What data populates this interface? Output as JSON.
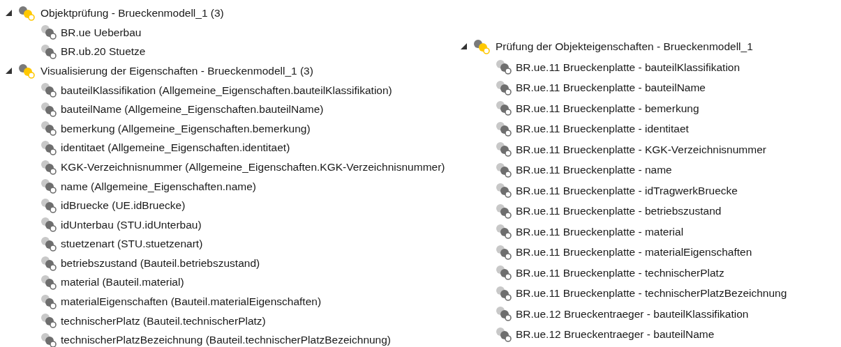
{
  "trees": [
    {
      "groups": [
        {
          "label": "Objektprüfung - Brueckenmodell_1 (3)",
          "expanded": true,
          "children": [
            {
              "label": "BR.ue Ueberbau"
            },
            {
              "label": "BR.ub.20 Stuetze"
            }
          ]
        },
        {
          "label": "Visualisierung der Eigenschaften - Brueckenmodell_1 (3)",
          "expanded": true,
          "children": [
            {
              "label": "bauteilKlassifikation (Allgemeine_Eigenschaften.bauteilKlassifikation)"
            },
            {
              "label": "bauteilName (Allgemeine_Eigenschaften.bauteilName)"
            },
            {
              "label": "bemerkung (Allgemeine_Eigenschaften.bemerkung)"
            },
            {
              "label": "identitaet (Allgemeine_Eigenschaften.identitaet)"
            },
            {
              "label": "KGK-Verzeichnisnummer (Allgemeine_Eigenschaften.KGK-Verzeichnisnummer)"
            },
            {
              "label": "name (Allgemeine_Eigenschaften.name)"
            },
            {
              "label": "idBruecke (UE.idBruecke)"
            },
            {
              "label": "idUnterbau (STU.idUnterbau)"
            },
            {
              "label": "stuetzenart (STU.stuetzenart)"
            },
            {
              "label": "betriebszustand (Bauteil.betriebszustand)"
            },
            {
              "label": "material (Bauteil.material)"
            },
            {
              "label": "materialEigenschaften (Bauteil.materialEigenschaften)"
            },
            {
              "label": "technischerPlatz (Bauteil.technischerPlatz)"
            },
            {
              "label": "technischerPlatzBezeichnung (Bauteil.technischerPlatzBezeichnung)"
            }
          ]
        }
      ]
    },
    {
      "groups": [
        {
          "label": "Prüfung der Objekteigenschaften - Brueckenmodell_1",
          "expanded": true,
          "children": [
            {
              "label": "BR.ue.11 Brueckenplatte - bauteilKlassifikation"
            },
            {
              "label": "BR.ue.11 Brueckenplatte - bauteilName"
            },
            {
              "label": "BR.ue.11 Brueckenplatte - bemerkung"
            },
            {
              "label": "BR.ue.11 Brueckenplatte - identitaet"
            },
            {
              "label": "BR.ue.11 Brueckenplatte - KGK-Verzeichnisnummer"
            },
            {
              "label": "BR.ue.11 Brueckenplatte - name"
            },
            {
              "label": "BR.ue.11 Brueckenplatte - idTragwerkBruecke"
            },
            {
              "label": "BR.ue.11 Brueckenplatte - betriebszustand"
            },
            {
              "label": "BR.ue.11 Brueckenplatte - material"
            },
            {
              "label": "BR.ue.11 Brueckenplatte - materialEigenschaften"
            },
            {
              "label": "BR.ue.11 Brueckenplatte - technischerPlatz"
            },
            {
              "label": "BR.ue.11 Brueckenplatte - technischerPlatzBezeichnung"
            },
            {
              "label": "BR.ue.12 Brueckentraeger - bauteilKlassifikation"
            },
            {
              "label": "BR.ue.12 Brueckentraeger - bauteilName"
            }
          ]
        }
      ]
    }
  ]
}
